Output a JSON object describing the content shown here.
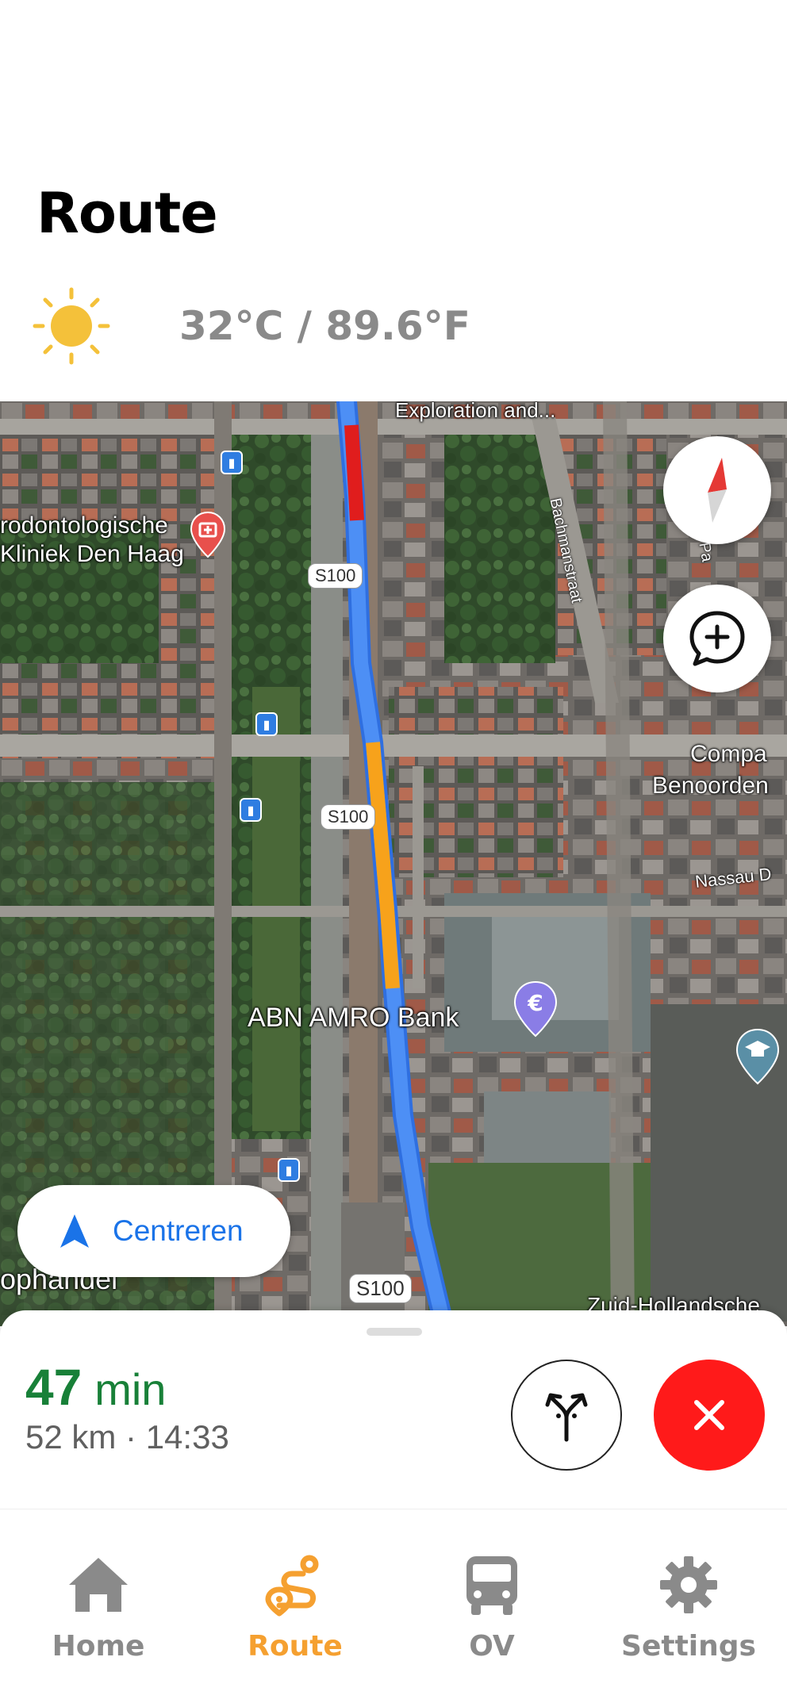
{
  "header": {
    "title": "Route",
    "weather": {
      "icon": "sun-icon",
      "text": "32°C / 89.6°F",
      "icon_color": "#f4c13a"
    }
  },
  "map": {
    "labels": {
      "clinic": "rodontologische",
      "clinic2": "Kliniek Den Haag",
      "bank": "ABN AMRO Bank",
      "top": "Exploration and...",
      "street1": "Bachmanstraat",
      "street2": "Nassau D",
      "company": "Compa",
      "company2": "Benoorden",
      "partial_pa": "Pa",
      "handel": "ophandel",
      "zuid": "Zuid-Hollandsche"
    },
    "road_shields": [
      "S100",
      "S100",
      "S100"
    ],
    "route_colors": {
      "normal": "#3b82f6",
      "heavy": "#e01d1d",
      "moderate": "#f7a21b"
    }
  },
  "controls": {
    "compass": "compass-icon",
    "report": "add-report-icon",
    "center_label": "Centreren"
  },
  "trip": {
    "duration_value": "47",
    "duration_unit": "min",
    "details": "52 km · 14:33",
    "eta_color": "#188038",
    "alternatives_icon": "route-split-icon",
    "close_icon": "close-icon"
  },
  "tabs": [
    {
      "label": "Home",
      "icon": "home-icon",
      "active": false
    },
    {
      "label": "Route",
      "icon": "route-icon",
      "active": true
    },
    {
      "label": "OV",
      "icon": "bus-icon",
      "active": false
    },
    {
      "label": "Settings",
      "icon": "gear-icon",
      "active": false
    }
  ],
  "accent_color": "#f5a030"
}
